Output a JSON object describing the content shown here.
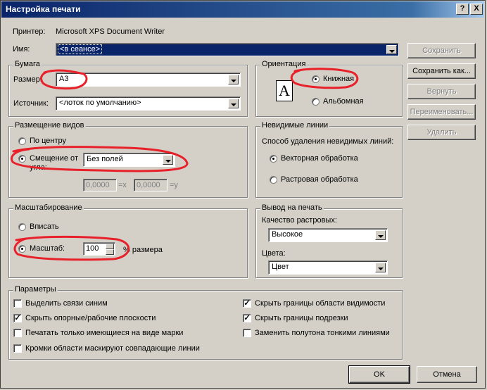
{
  "window": {
    "title": "Настройка печати"
  },
  "titlebar_buttons": {
    "help": "?",
    "close": "X"
  },
  "printer": {
    "label": "Принтер:",
    "value": "Microsoft XPS Document Writer",
    "name_label": "Имя:",
    "name_value": "<в сеансе>"
  },
  "paper": {
    "group": "Бумага",
    "size_label": "Размер:",
    "size_value": "A3",
    "source_label": "Источник:",
    "source_value": "<лоток по умолчанию>"
  },
  "orientation": {
    "group": "Ориентация",
    "portrait": "Книжная",
    "landscape": "Альбомная",
    "selected": "portrait",
    "icon_letter": "A"
  },
  "placement": {
    "group": "Размещение видов",
    "center": "По центру",
    "offset": "Смещение от угла:",
    "offset_value": "Без полей",
    "x_value": "0,0000",
    "x_label": "=x",
    "y_value": "0,0000",
    "y_label": "=y",
    "selected": "offset"
  },
  "hidden_lines": {
    "group": "Невидимые линии",
    "method_label": "Способ удаления невидимых линий:",
    "vector": "Векторная обработка",
    "raster": "Растровая обработка",
    "selected": "vector"
  },
  "scaling": {
    "group": "Масштабирование",
    "fit": "Вписать",
    "scale": "Масштаб:",
    "scale_value": "100",
    "scale_suffix": "% размера",
    "selected": "scale"
  },
  "output": {
    "group": "Вывод на печать",
    "quality_label": "Качество растровых:",
    "quality_value": "Высокое",
    "colors_label": "Цвета:",
    "colors_value": "Цвет"
  },
  "params": {
    "group": "Параметры",
    "left": [
      {
        "label": "Выделить связи синим",
        "checked": false
      },
      {
        "label": "Скрыть опорные/рабочие плоскости",
        "checked": true
      },
      {
        "label": "Печатать только имеющиеся на виде марки",
        "checked": false
      },
      {
        "label": "Кромки области маскируют совпадающие линии",
        "checked": false
      }
    ],
    "right": [
      {
        "label": "Скрыть границы области видимости",
        "checked": true
      },
      {
        "label": "Скрыть границы подрезки",
        "checked": true
      },
      {
        "label": "Заменить полутона тонкими линиями",
        "checked": false
      }
    ]
  },
  "side_buttons": {
    "save": "Сохранить",
    "save_as": "Сохранить как...",
    "revert": "Вернуть",
    "rename": "Переименовать...",
    "delete": "Удалить"
  },
  "footer": {
    "ok": "OK",
    "cancel": "Отмена"
  },
  "colors": {
    "title_start": "#0a246a",
    "title_end": "#a6caf0",
    "annotation": "#e8202a",
    "face": "#d4d0c8"
  }
}
